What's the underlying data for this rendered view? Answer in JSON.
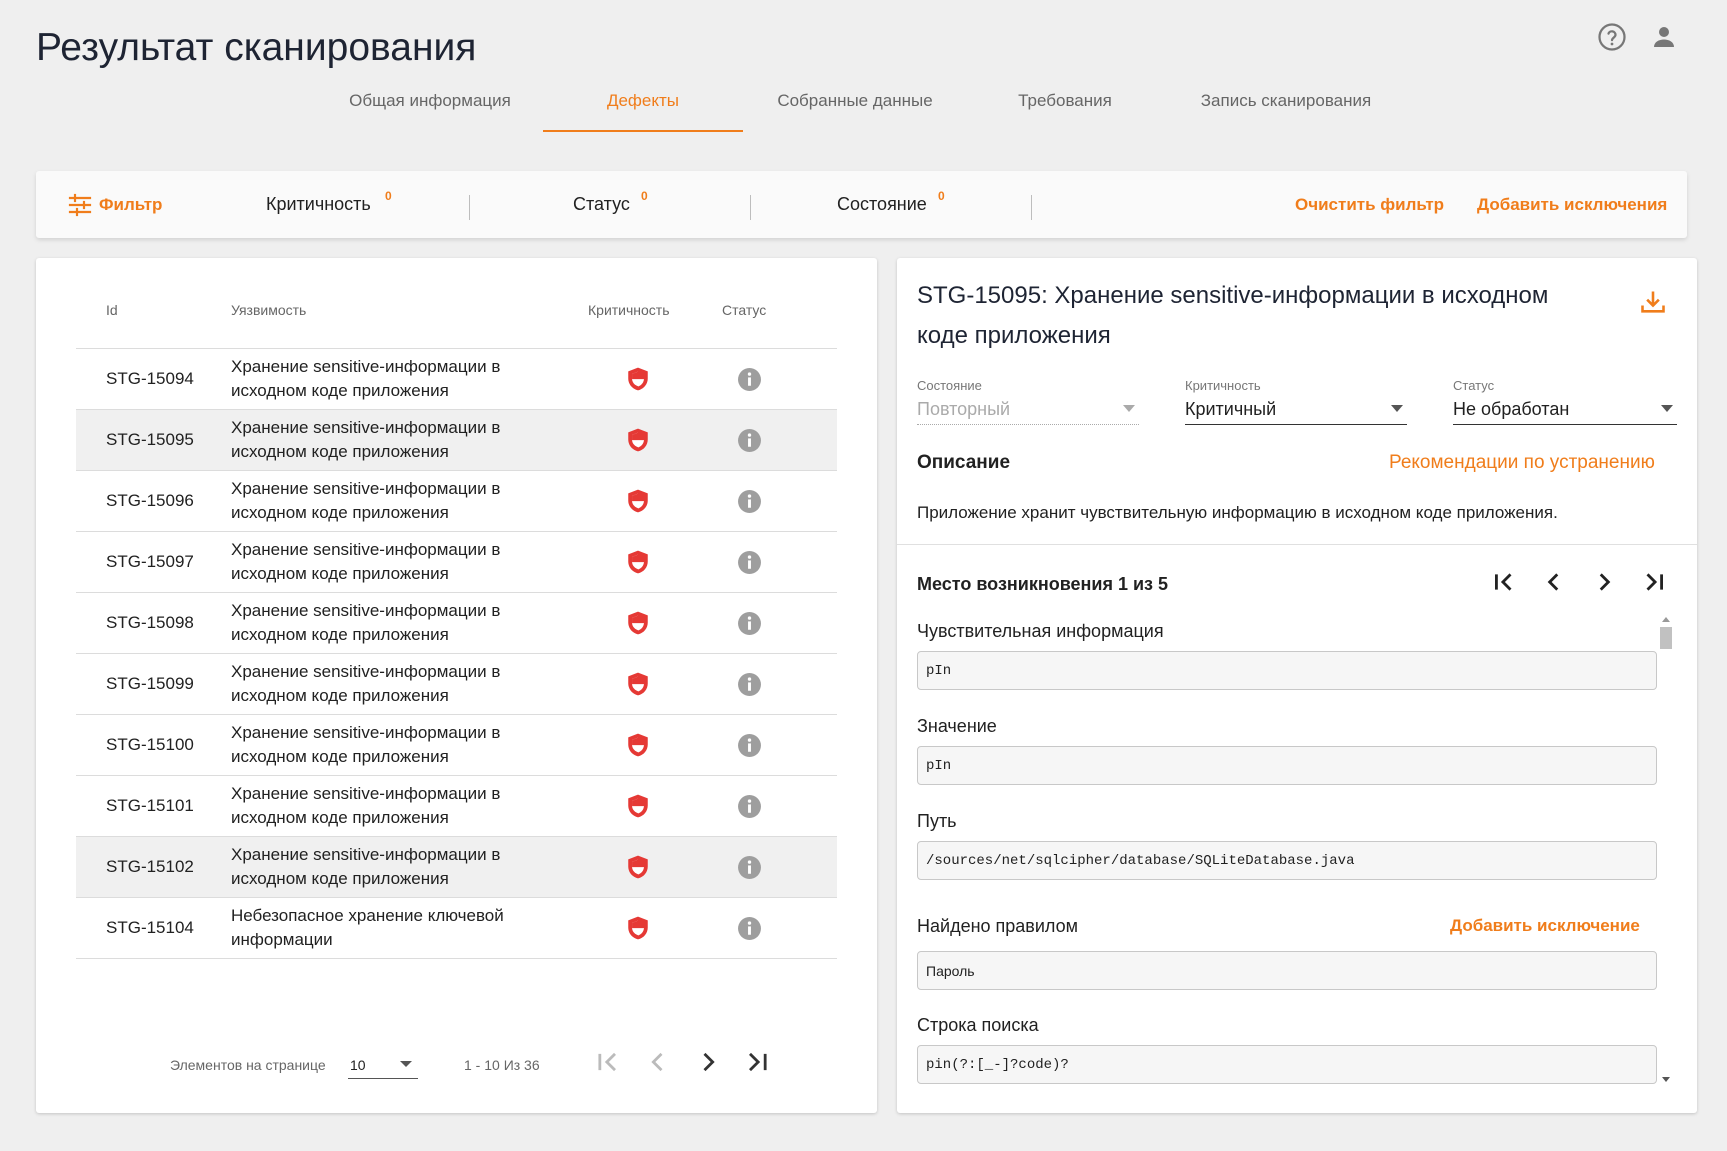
{
  "page_title": "Результат сканирования",
  "tabs": [
    {
      "label": "Общая информация",
      "active": false
    },
    {
      "label": "Дефекты",
      "active": true
    },
    {
      "label": "Собранные данные",
      "active": false
    },
    {
      "label": "Требования",
      "active": false
    },
    {
      "label": "Запись сканирования",
      "active": false
    }
  ],
  "filter_bar": {
    "filter_label": "Фильтр",
    "criticality_label": "Критичность",
    "criticality_count": "0",
    "status_label": "Статус",
    "status_count": "0",
    "state_label": "Состояние",
    "state_count": "0",
    "clear_label": "Очистить фильтр",
    "add_exclusions_label": "Добавить исключения"
  },
  "table": {
    "headers": {
      "id": "Id",
      "vulnerability": "Уязвимость",
      "criticality": "Критичность",
      "status": "Статус"
    },
    "rows": [
      {
        "id": "STG-15094",
        "vuln": "Хранение sensitive-информации в исходном коде приложения",
        "selected": false
      },
      {
        "id": "STG-15095",
        "vuln": "Хранение sensitive-информации в исходном коде приложения",
        "selected": true
      },
      {
        "id": "STG-15096",
        "vuln": "Хранение sensitive-информации в исходном коде приложения",
        "selected": false
      },
      {
        "id": "STG-15097",
        "vuln": "Хранение sensitive-информации в исходном коде приложения",
        "selected": false
      },
      {
        "id": "STG-15098",
        "vuln": "Хранение sensitive-информации в исходном коде приложения",
        "selected": false
      },
      {
        "id": "STG-15099",
        "vuln": "Хранение sensitive-информации в исходном коде приложения",
        "selected": false
      },
      {
        "id": "STG-15100",
        "vuln": "Хранение sensitive-информации в исходном коде приложения",
        "selected": false
      },
      {
        "id": "STG-15101",
        "vuln": "Хранение sensitive-информации в исходном коде приложения",
        "selected": false
      },
      {
        "id": "STG-15102",
        "vuln": "Хранение sensitive-информации в исходном коде приложения",
        "selected": true
      },
      {
        "id": "STG-15104",
        "vuln": "Небезопасное хранение ключевой информации",
        "selected": false
      }
    ]
  },
  "pagination": {
    "items_per_page_label": "Элементов на странице",
    "items_per_page": "10",
    "range": "1 - 10 Из 36"
  },
  "detail": {
    "title": "STG-15095: Хранение sensitive-информации в исходном коде приложения",
    "state_label": "Состояние",
    "state_value": "Повторный",
    "criticality_label": "Критичность",
    "criticality_value": "Критичный",
    "status_label": "Статус",
    "status_value": "Не обработан",
    "description_heading": "Описание",
    "recommendations_link": "Рекомендации по устранению",
    "description_text": "Приложение хранит чувствительную информацию в исходном коде приложения.",
    "occurrence_heading": "Место возникновения 1 из 5",
    "fields": {
      "sensitive_label": "Чувствительная информация",
      "sensitive_value": "pIn",
      "value_label": "Значение",
      "value_value": "pIn",
      "path_label": "Путь",
      "path_value": "/sources/net/sqlcipher/database/SQLiteDatabase.java",
      "rule_label": "Найдено правилом",
      "add_exclusion_label": "Добавить исключение",
      "rule_value": "Пароль",
      "search_label": "Строка поиска",
      "search_value": "pin(?:[_-]?code)?"
    }
  },
  "colors": {
    "accent": "#f07d1b",
    "critical": "#e53935",
    "status_icon": "#9e9e9e"
  },
  "icons": {
    "help": "help-circle-icon",
    "user": "user-icon",
    "filter": "sliders-icon",
    "critical": "shield-icon",
    "status": "info-icon",
    "download": "download-icon"
  }
}
